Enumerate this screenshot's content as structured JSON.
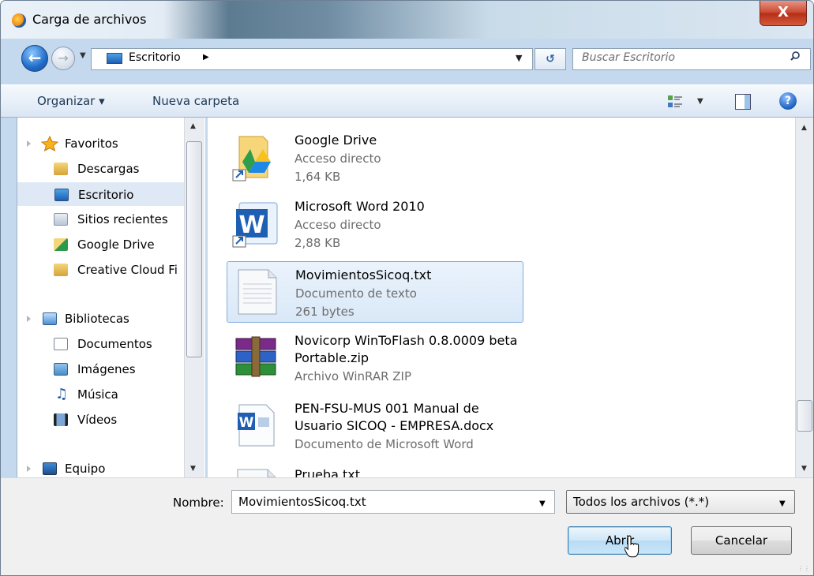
{
  "window": {
    "title": "Carga de archivos",
    "close_glyph": "X"
  },
  "address": {
    "location": "Escritorio",
    "search_placeholder": "Buscar Escritorio"
  },
  "toolbar": {
    "organize_label": "Organizar ▾",
    "new_folder_label": "Nueva carpeta"
  },
  "sidebar": {
    "items": [
      {
        "label": "Favoritos",
        "icon": "star-icon"
      },
      {
        "label": "Descargas",
        "icon": "downloads-folder-icon"
      },
      {
        "label": "Escritorio",
        "icon": "desktop-icon"
      },
      {
        "label": "Sitios recientes",
        "icon": "recent-places-icon"
      },
      {
        "label": "Google Drive",
        "icon": "google-drive-folder-icon"
      },
      {
        "label": "Creative Cloud Fi",
        "icon": "folder-icon"
      },
      {
        "label": "Bibliotecas",
        "icon": "libraries-icon"
      },
      {
        "label": "Documentos",
        "icon": "documents-icon"
      },
      {
        "label": "Imágenes",
        "icon": "pictures-icon"
      },
      {
        "label": "Música",
        "icon": "music-icon"
      },
      {
        "label": "Vídeos",
        "icon": "videos-icon"
      },
      {
        "label": "Equipo",
        "icon": "computer-icon"
      }
    ]
  },
  "files": [
    {
      "name": "Google Drive",
      "name2": "",
      "type": "Acceso directo",
      "size": "1,64 KB"
    },
    {
      "name": "Microsoft Word 2010",
      "name2": "",
      "type": "Acceso directo",
      "size": "2,88 KB"
    },
    {
      "name": "MovimientosSicoq.txt",
      "name2": "",
      "type": "Documento de texto",
      "size": "261 bytes"
    },
    {
      "name": "Novicorp WinToFlash 0.8.0009 beta",
      "name2": "Portable.zip",
      "type": "Archivo WinRAR ZIP",
      "size": ""
    },
    {
      "name": "PEN-FSU-MUS 001 Manual de",
      "name2": "Usuario SICOQ - EMPRESA.docx",
      "type": "Documento de Microsoft Word",
      "size": ""
    },
    {
      "name": "Prueba.txt",
      "name2": "",
      "type": "",
      "size": ""
    }
  ],
  "footer": {
    "name_label": "Nombre:",
    "name_value": "MovimientosSicoq.txt",
    "filter_value": "Todos los archivos (*.*)",
    "open_label": "Abrir",
    "cancel_label": "Cancelar"
  },
  "colors": {
    "accent": "#3c7fb1",
    "selection": "#dfe9f5",
    "meta_text": "#6d6d6d"
  }
}
